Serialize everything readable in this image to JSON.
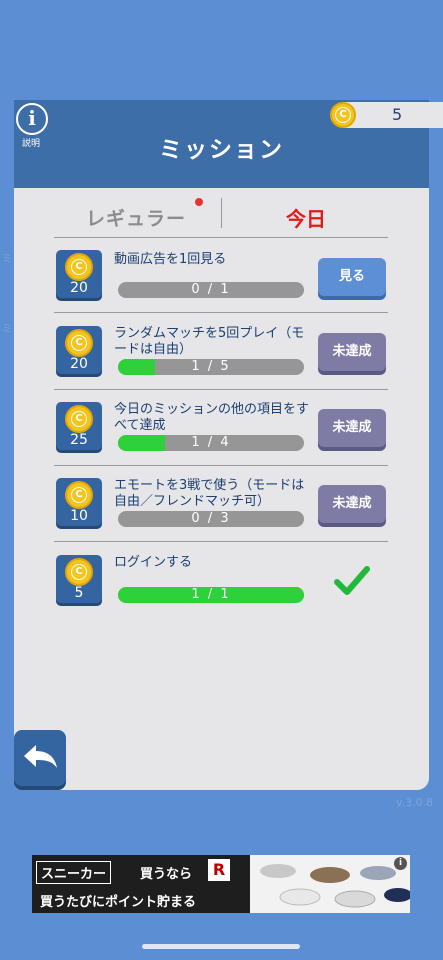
{
  "header": {
    "title": "ミッション",
    "info_label": "説明",
    "coins": "5"
  },
  "tabs": {
    "regular": "レギュラー",
    "today": "今日"
  },
  "missions": [
    {
      "reward": "20",
      "text": "動画広告を1回見る",
      "progress": "0 / 1",
      "fill": 0.0,
      "action": "見る"
    },
    {
      "reward": "20",
      "text": "ランダムマッチを5回プレイ（モードは自由）",
      "progress": "1 / 5",
      "fill": 0.2,
      "action": "未達成"
    },
    {
      "reward": "25",
      "text": "今日のミッションの他の項目をすべて達成",
      "progress": "1 / 4",
      "fill": 0.25,
      "action": "未達成"
    },
    {
      "reward": "10",
      "text": "エモートを3戦で使う（モードは自由／フレンドマッチ可）",
      "progress": "0 / 3",
      "fill": 0.0,
      "action": "未達成"
    },
    {
      "reward": "5",
      "text": "ログインする",
      "progress": "1 / 1",
      "fill": 1.0,
      "action": ""
    }
  ],
  "version": "v.3.0.8",
  "ad": {
    "line1": "スニーカー",
    "line1b": "買うなら",
    "logo": "R",
    "line2": "買うたびにポイント貯まる"
  },
  "colors": {
    "accent": "#3d6ea8",
    "progress": "#2fd13a",
    "alert": "#e11a1a"
  }
}
